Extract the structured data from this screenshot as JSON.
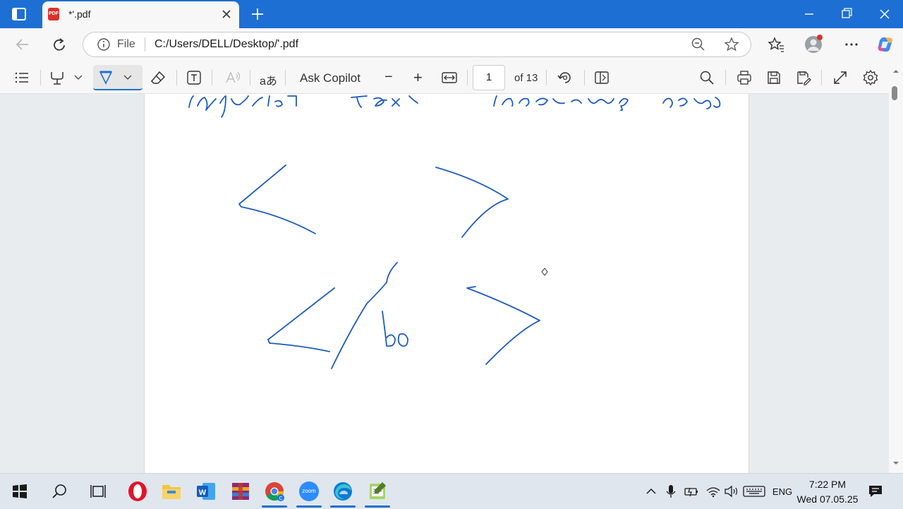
{
  "browser": {
    "tab_title": "*'.pdf",
    "new_tab_symbol": "+",
    "address_prefix": "File",
    "address": "C:/Users/DELL/Desktop/'.pdf",
    "accent": "#1d6fd4"
  },
  "pdf_toolbar": {
    "ask_copilot": "Ask Copilot",
    "page_current": "1",
    "page_total": "of 13",
    "zoom_out": "−",
    "zoom_in": "+",
    "translate_glyph": "aあ"
  },
  "document": {
    "handwritten_bottom": "bo",
    "ink_color": "#1e5bbf"
  },
  "taskbar": {
    "language": "ENG",
    "time": "7:22 PM",
    "date": "Wed 07.05.25",
    "apps": [
      "start-icon",
      "search-icon",
      "task-view-icon",
      "opera-icon",
      "file-explorer-icon",
      "word-icon",
      "winrar-icon",
      "chrome-icon",
      "zoom-icon",
      "edge-icon",
      "notepad-icon"
    ],
    "zoom_label": "zoom"
  }
}
